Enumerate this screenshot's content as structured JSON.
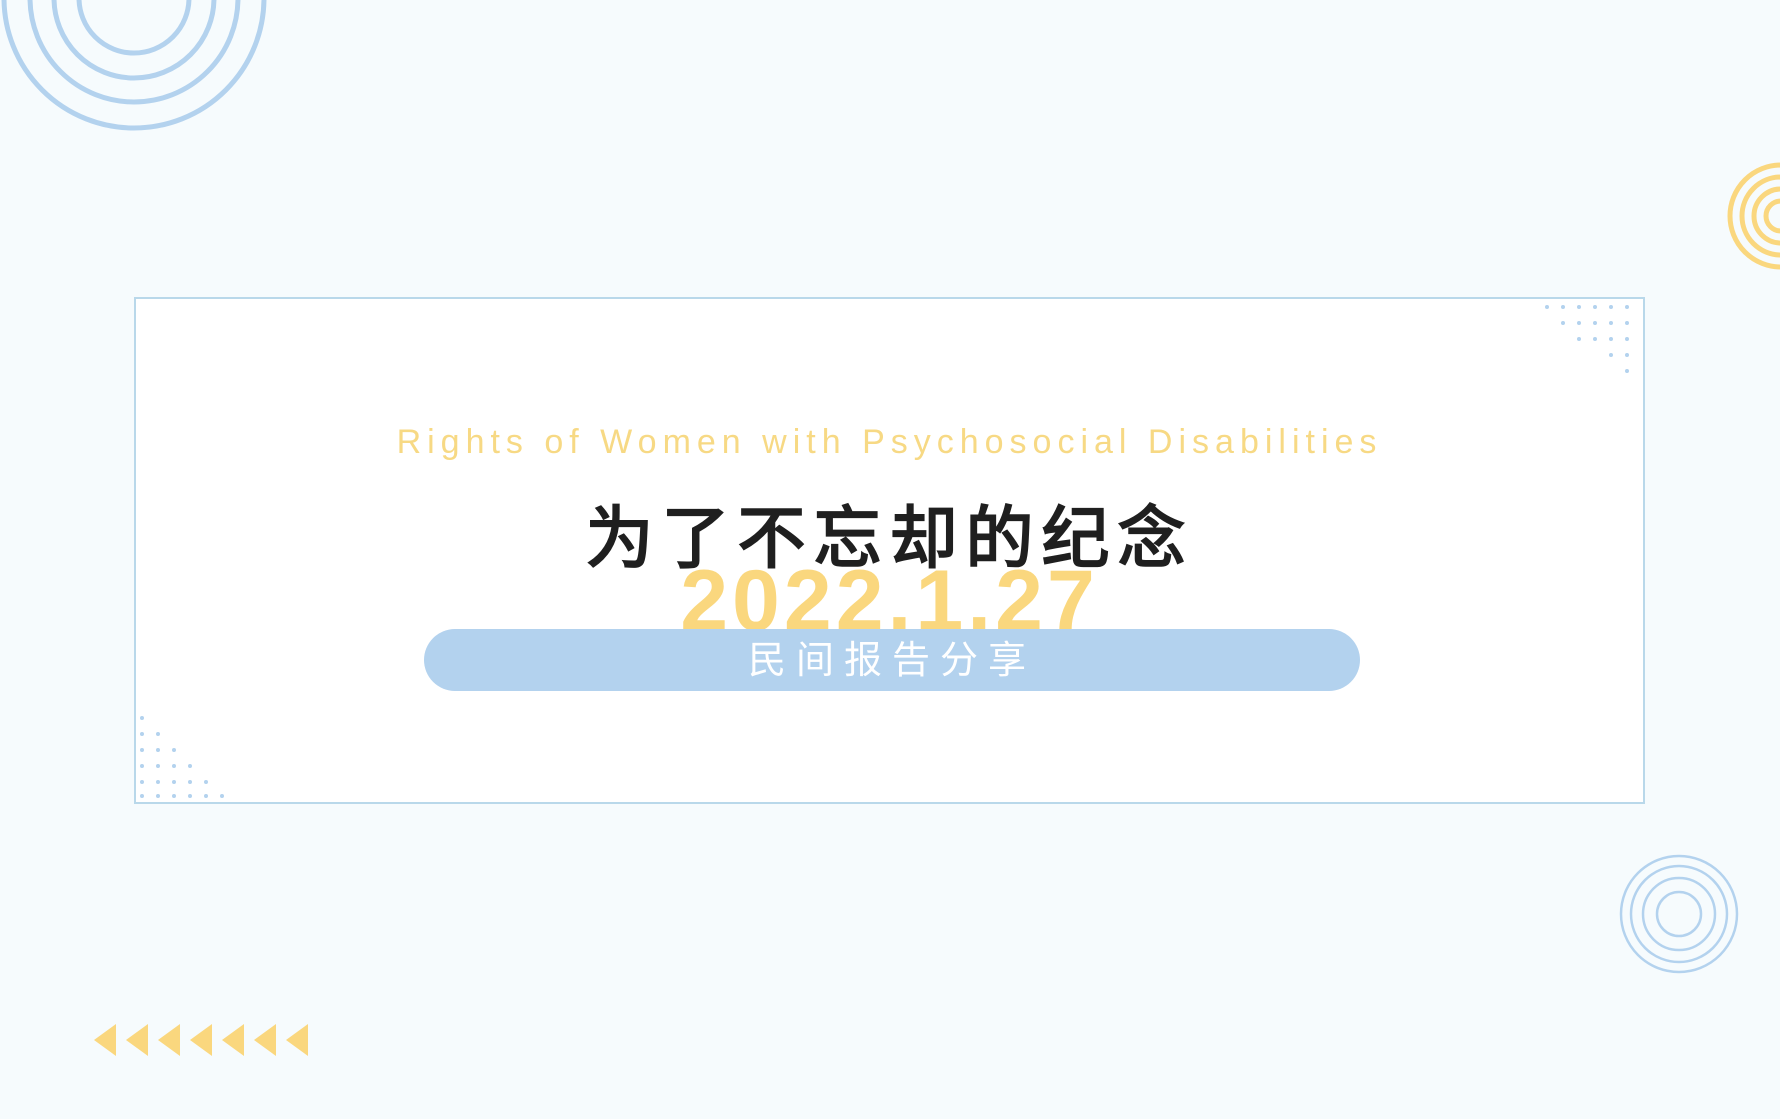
{
  "slide": {
    "subtitle": "Rights of Women with Psychosocial Disabilities",
    "title": "为了不忘却的纪念",
    "date": "2022.1.27",
    "tag": "民间报告分享"
  },
  "colors": {
    "background": "#f6fbfd",
    "frame_border": "#b9d8ea",
    "accent_blue": "#b3d2ee",
    "accent_yellow": "#fad77e",
    "title_text": "#1f1f1f"
  },
  "decorations": {
    "top_left": "concentric-rings-icon",
    "top_right": "concentric-rings-icon",
    "bottom_right": "concentric-rings-icon",
    "bottom_left": "left-arrows-icon",
    "frame_corners": "dot-grid-icon"
  }
}
